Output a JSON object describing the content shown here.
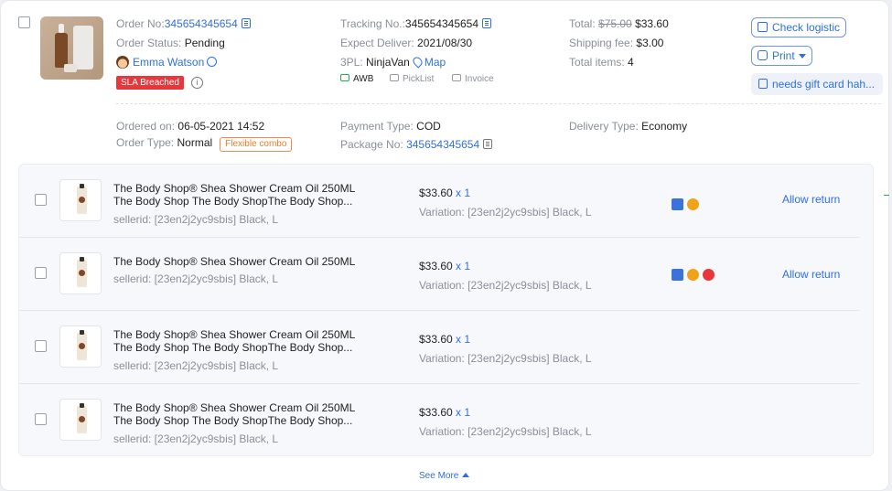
{
  "order": {
    "order_no_label": "Order No:",
    "order_no": "345654345654",
    "status_label": "Order Status:",
    "status": "Pending",
    "buyer": "Emma Watson",
    "sla_badge": "SLA Breached",
    "tracking_label": "Tracking No.:",
    "tracking_no": "345654345654",
    "expect_label": "Expect Deliver:",
    "expect_date": "2021/08/30",
    "tpl_label": "3PL:",
    "tpl": "NinjaVan",
    "map_link": "Map",
    "doc_awb": "AWB",
    "doc_picklist": "PickList",
    "doc_invoice": "Invoice",
    "total_label": "Total:",
    "total_original": "$75.00",
    "total": "$33.60",
    "shipping_label": "Shipping fee:",
    "shipping": "$3.00",
    "items_label": "Total items:",
    "items_count": "4",
    "check_logistic": "Check logistic",
    "print": "Print",
    "note": "needs gift card hah...",
    "ordered_on_label": "Ordered on:",
    "ordered_on": "06-05-2021 14:52",
    "order_type_label": "Order Type:",
    "order_type": "Normal",
    "order_tag": "Flexible combo",
    "payment_label": "Payment Type:",
    "payment": "COD",
    "package_label": "Package No:",
    "package_no": "345654345654",
    "delivery_label": "Delivery Type:",
    "delivery": "Economy"
  },
  "items": [
    {
      "name1": "The Body Shop® Shea Shower Cream Oil 250ML",
      "name2": "The Body Shop The Body ShopThe Body Shop...",
      "sku": "sellerid: [23en2j2yc9sbis] Black, L",
      "price": "$33.60",
      "qty": "x 1",
      "variation": "Variation: [23en2j2yc9sbis] Black, L",
      "action": "Allow return"
    },
    {
      "name1": "The Body Shop® Shea Shower Cream Oil 250ML",
      "name2": "",
      "sku": "sellerid: [23en2j2yc9sbis] Black, L",
      "price": "$33.60",
      "qty": "x 1",
      "variation": "Variation: [23en2j2yc9sbis] Black, L",
      "action": "Allow return"
    },
    {
      "name1": "The Body Shop® Shea Shower Cream Oil 250ML",
      "name2": "The Body Shop The Body ShopThe Body Shop...",
      "sku": "sellerid: [23en2j2yc9sbis] Black, L",
      "price": "$33.60",
      "qty": "x 1",
      "variation": "Variation: [23en2j2yc9sbis] Black, L",
      "action": ""
    },
    {
      "name1": "The Body Shop® Shea Shower Cream Oil 250ML",
      "name2": "The Body Shop The Body ShopThe Body Shop...",
      "sku": "sellerid: [23en2j2yc9sbis] Black, L",
      "price": "$33.60",
      "qty": "x 1",
      "variation": "Variation: [23en2j2yc9sbis] Black, L",
      "action": ""
    }
  ],
  "see_more": "See More"
}
